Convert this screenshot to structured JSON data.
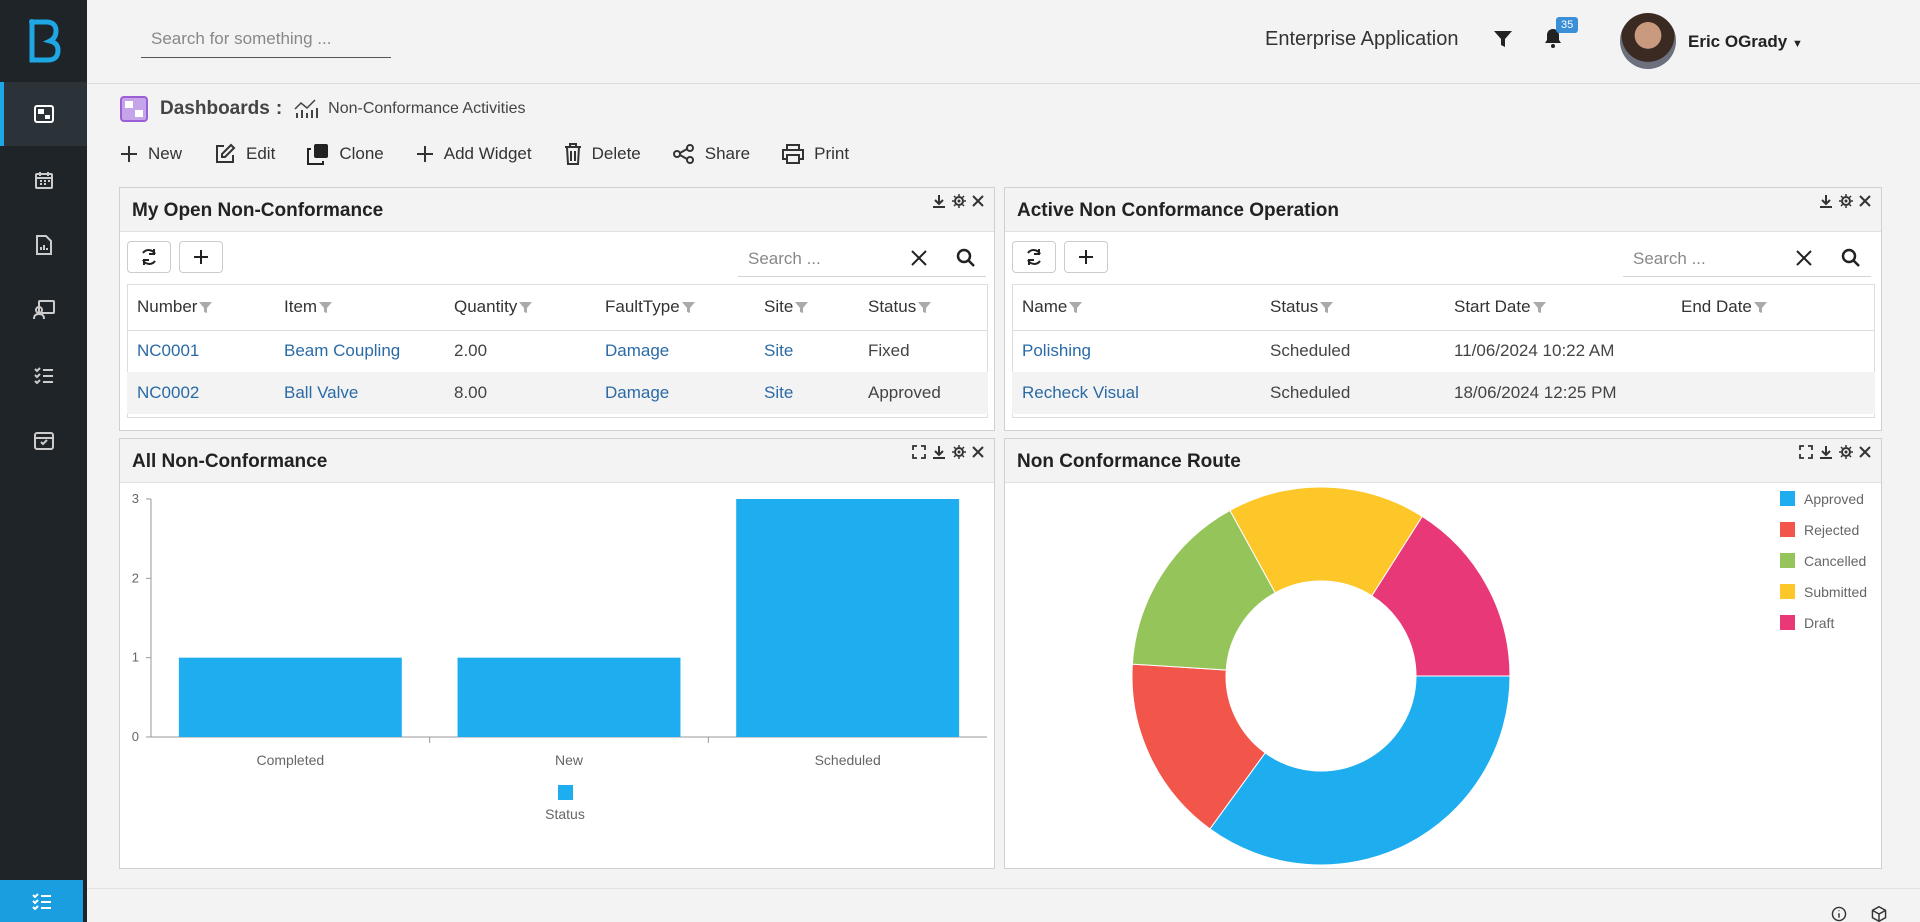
{
  "header": {
    "search_placeholder": "Search for something ...",
    "app_name": "Enterprise Application",
    "notification_count": "35",
    "user_name": "Eric OGrady"
  },
  "sidebar": {
    "items": [
      {
        "name": "dashboard",
        "icon": "dashboard-icon",
        "active": true
      },
      {
        "name": "calendar",
        "icon": "calendar-icon"
      },
      {
        "name": "reports",
        "icon": "report-icon"
      },
      {
        "name": "users",
        "icon": "user-card-icon"
      },
      {
        "name": "tasks",
        "icon": "checklist-icon"
      },
      {
        "name": "inbox",
        "icon": "inbox-icon"
      }
    ]
  },
  "breadcrumb": {
    "root": "Dashboards",
    "separator": ":",
    "page": "Non-Conformance Activities"
  },
  "toolbar": {
    "new": "New",
    "edit": "Edit",
    "clone": "Clone",
    "add_widget": "Add Widget",
    "delete": "Delete",
    "share": "Share",
    "print": "Print"
  },
  "panels": {
    "open_nc": {
      "title": "My Open Non-Conformance",
      "search_placeholder": "Search ...",
      "columns": [
        "Number",
        "Item",
        "Quantity",
        "FaultType",
        "Site",
        "Status"
      ],
      "rows": [
        [
          "NC0001",
          "Beam Coupling",
          "2.00",
          "Damage",
          "Site",
          "Fixed"
        ],
        [
          "NC0002",
          "Ball Valve",
          "8.00",
          "Damage",
          "Site",
          "Approved"
        ]
      ]
    },
    "active_ops": {
      "title": "Active Non Conformance Operation",
      "search_placeholder": "Search ...",
      "columns": [
        "Name",
        "Status",
        "Start Date",
        "End Date"
      ],
      "rows": [
        [
          "Polishing",
          "Scheduled",
          "11/06/2024 10:22 AM",
          ""
        ],
        [
          "Recheck Visual",
          "Scheduled",
          "18/06/2024 12:25 PM",
          ""
        ]
      ]
    },
    "all_nc": {
      "title": "All Non-Conformance"
    },
    "route": {
      "title": "Non Conformance Route"
    }
  },
  "chart_data": [
    {
      "type": "bar",
      "categories": [
        "Completed",
        "New",
        "Scheduled"
      ],
      "series": [
        {
          "name": "Status",
          "values": [
            1,
            1,
            3
          ]
        }
      ],
      "ylim": [
        0,
        3
      ],
      "yticks": [
        0,
        1,
        2,
        3
      ],
      "legend": "bottom",
      "color": "#1eaef0"
    },
    {
      "type": "pie",
      "donut": true,
      "labels": [
        "Approved",
        "Rejected",
        "Cancelled",
        "Submitted",
        "Draft"
      ],
      "values": [
        35,
        16,
        16,
        17,
        16
      ],
      "colors": [
        "#1eaef0",
        "#f2554a",
        "#95c45a",
        "#fdc72a",
        "#e83877"
      ],
      "legend": "top-right"
    }
  ]
}
